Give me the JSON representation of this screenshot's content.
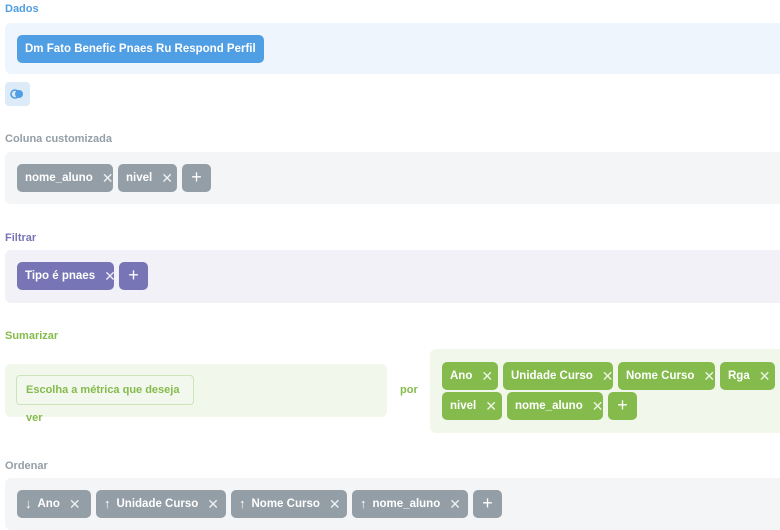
{
  "dados": {
    "title": "Dados",
    "table": "Dm Fato Benefic Pnaes Ru Respond Perfil"
  },
  "custom_column": {
    "title": "Coluna customizada",
    "items": [
      "nome_aluno",
      "nivel"
    ]
  },
  "filter": {
    "title": "Filtrar",
    "items": [
      "Tipo é pnaes"
    ]
  },
  "summarize": {
    "title": "Sumarizar",
    "metric_placeholder": "Escolha a métrica que deseja ver",
    "by_label": "por",
    "groups": [
      "Ano",
      "Unidade Curso",
      "Nome Curso",
      "Rga",
      "nivel",
      "nome_aluno"
    ]
  },
  "order": {
    "title": "Ordenar",
    "items": [
      {
        "label": "Ano",
        "direction": "desc"
      },
      {
        "label": "Unidade Curso",
        "direction": "asc"
      },
      {
        "label": "Nome Curso",
        "direction": "asc"
      },
      {
        "label": "nome_aluno",
        "direction": "asc"
      }
    ]
  },
  "icons": {
    "close": "close-icon",
    "add": "plus-icon",
    "toggle": "toggle-icon",
    "asc": "arrow-up-icon",
    "desc": "arrow-down-icon"
  },
  "colors": {
    "blue": "#509ee3",
    "gray": "#939ea6",
    "purple": "#7775b5",
    "green": "#84bb4c"
  }
}
